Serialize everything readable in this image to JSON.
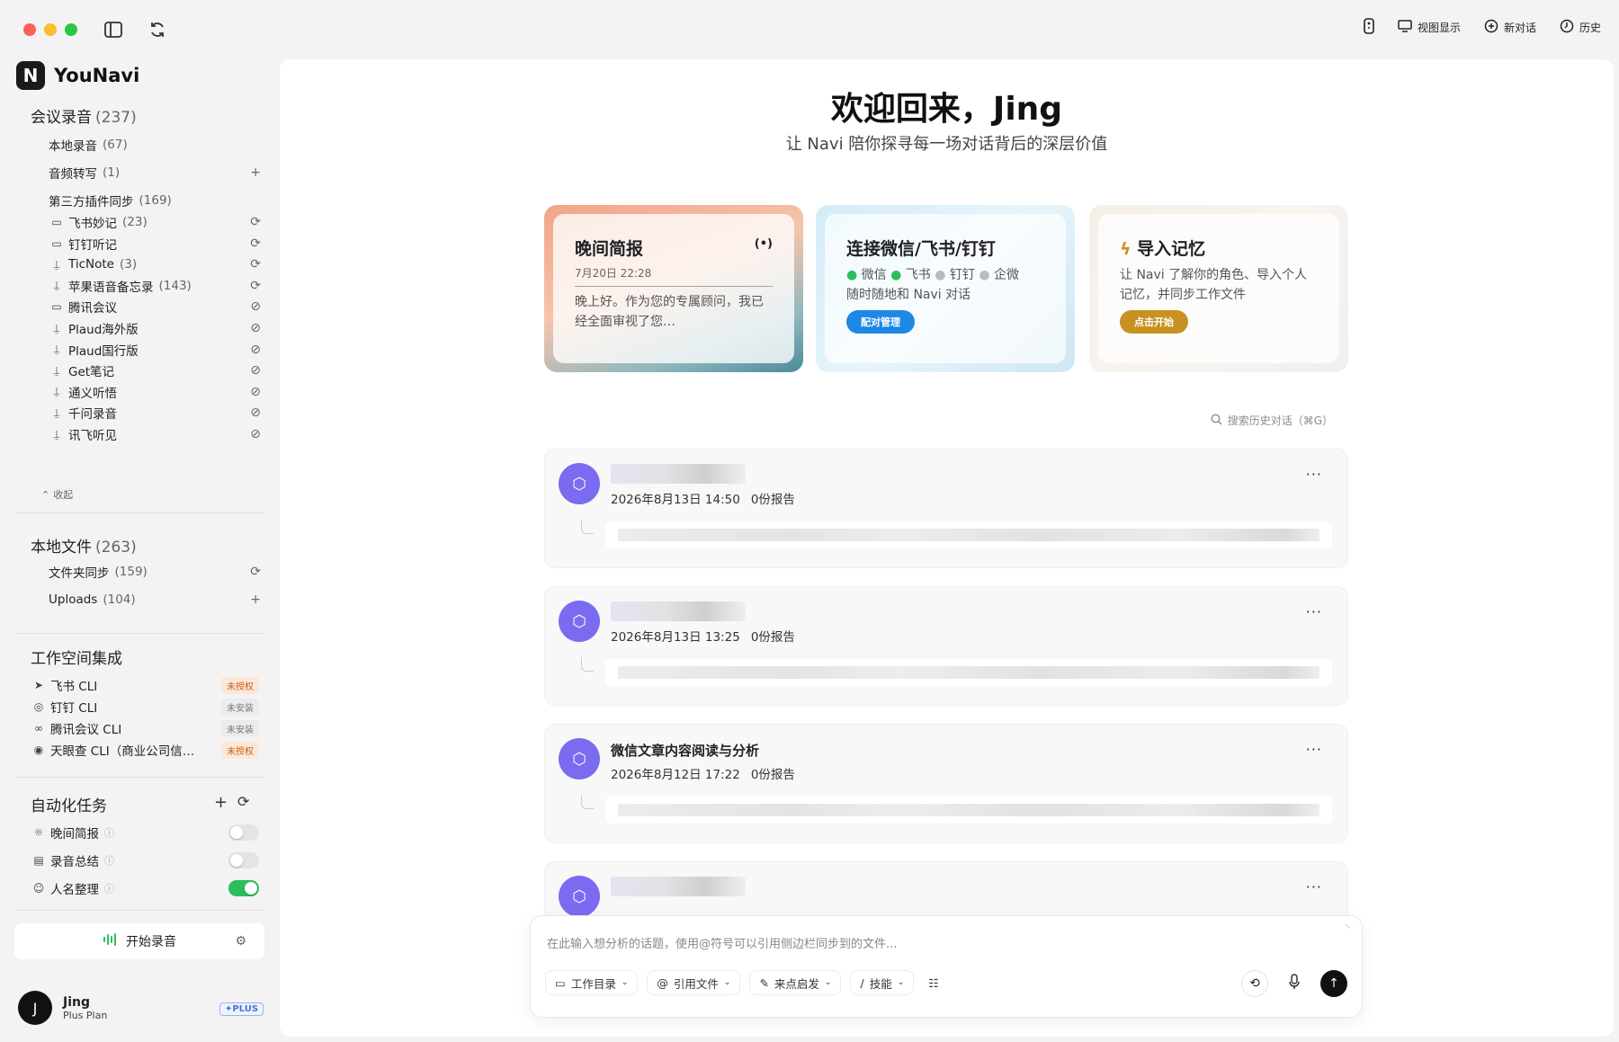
{
  "window": {
    "actions": [
      {
        "icon": "remote-icon",
        "label": ""
      },
      {
        "icon": "monitor-icon",
        "label": "视图显示"
      },
      {
        "icon": "plus-circle-icon",
        "label": "新对话"
      },
      {
        "icon": "clock-icon",
        "label": "历史"
      }
    ]
  },
  "brand": {
    "name": "YouNavi",
    "logo": "N"
  },
  "meetings": {
    "title": "会议录音",
    "count": "(237)",
    "items": [
      {
        "label": "本地录音",
        "count": "(67)",
        "action": ""
      },
      {
        "label": "音频转写",
        "count": "(1)",
        "action": "+"
      },
      {
        "label": "第三方插件同步",
        "count": "(169)",
        "action": ""
      }
    ],
    "plugins": [
      {
        "icon": "camera",
        "label": "飞书妙记",
        "count": "(23)",
        "action": "sync"
      },
      {
        "icon": "camera",
        "label": "钉钉听记",
        "count": "",
        "action": "sync"
      },
      {
        "icon": "mic",
        "label": "TicNote",
        "count": "(3)",
        "action": "sync"
      },
      {
        "icon": "mic",
        "label": "苹果语音备忘录",
        "count": "(143)",
        "action": "sync"
      },
      {
        "icon": "camera",
        "label": "腾讯会议",
        "count": "",
        "action": "nosync"
      },
      {
        "icon": "mic",
        "label": "Plaud海外版",
        "count": "",
        "action": "nosync"
      },
      {
        "icon": "mic",
        "label": "Plaud国行版",
        "count": "",
        "action": "nosync"
      },
      {
        "icon": "mic",
        "label": "Get笔记",
        "count": "",
        "action": "nosync"
      },
      {
        "icon": "mic",
        "label": "通义听悟",
        "count": "",
        "action": "nosync"
      },
      {
        "icon": "mic",
        "label": "千问录音",
        "count": "",
        "action": "nosync"
      },
      {
        "icon": "mic",
        "label": "讯飞听见",
        "count": "",
        "action": "nosync"
      }
    ],
    "collapse": "收起"
  },
  "local_files": {
    "title": "本地文件",
    "count": "(263)",
    "items": [
      {
        "label": "文件夹同步",
        "count": "(159)"
      },
      {
        "label": "Uploads",
        "count": "(104)"
      }
    ]
  },
  "workspace": {
    "title": "工作空间集成",
    "items": [
      {
        "label": "飞书 CLI",
        "badge": "未授权",
        "icon": "send-icon"
      },
      {
        "label": "钉钉 CLI",
        "badge": "未安装",
        "icon": "dingtalk-icon"
      },
      {
        "label": "腾讯会议 CLI",
        "badge": "未安装",
        "icon": "tencent-meeting-icon"
      },
      {
        "label": "天眼查 CLI（商业公司信…",
        "badge": "未授权",
        "icon": "eye-icon"
      }
    ]
  },
  "automation": {
    "title": "自动化任务",
    "items": [
      {
        "label": "晚间简报",
        "on": false
      },
      {
        "label": "录音总结",
        "on": false
      },
      {
        "label": "人名整理",
        "on": true
      }
    ]
  },
  "record_button": "开始录音",
  "user": {
    "initial": "J",
    "name": "Jing",
    "plan": "Plus Plan",
    "badge": "✦PLUS"
  },
  "hero": {
    "title": "欢迎回来，Jing",
    "subtitle": "让 Navi 陪你探寻每一场对话背后的深层价值"
  },
  "cards": {
    "briefing": {
      "title": "晚间简报",
      "date": "7月20日  22:28",
      "text": "晚上好。作为您的专属顾问，我已经全面审视了您…"
    },
    "connect": {
      "title": "连接微信/飞书/钉钉",
      "apps": [
        "微信",
        "飞书",
        "钉钉",
        "企微"
      ],
      "text": "随时随地和 Navi 对话",
      "button": "配对管理"
    },
    "memory": {
      "title": "导入记忆",
      "text": "让 Navi 了解你的角色、导入个人记忆，并同步工作文件",
      "button": "点击开始"
    }
  },
  "search_history": "搜索历史对话（⌘G）",
  "conversations": [
    {
      "title": "",
      "date": "2026年8月13日 14:50",
      "reports": "0份报告"
    },
    {
      "title": "",
      "date": "2026年8月13日 13:25",
      "reports": "0份报告"
    },
    {
      "title": "微信文章内容阅读与分析",
      "date": "2026年8月12日 17:22",
      "reports": "0份报告"
    },
    {
      "title": "",
      "date": "",
      "reports": ""
    }
  ],
  "composer": {
    "placeholder": "在此输入想分析的话题，使用@符号可以引用侧边栏同步到的文件...",
    "chips": [
      "工作目录",
      "引用文件",
      "来点启发",
      "技能"
    ]
  },
  "colors": {
    "accent": "#7a6bf0",
    "toggle_on": "#2bbf5c",
    "pair_btn": "#1e88e5",
    "start_btn": "#c89220"
  }
}
